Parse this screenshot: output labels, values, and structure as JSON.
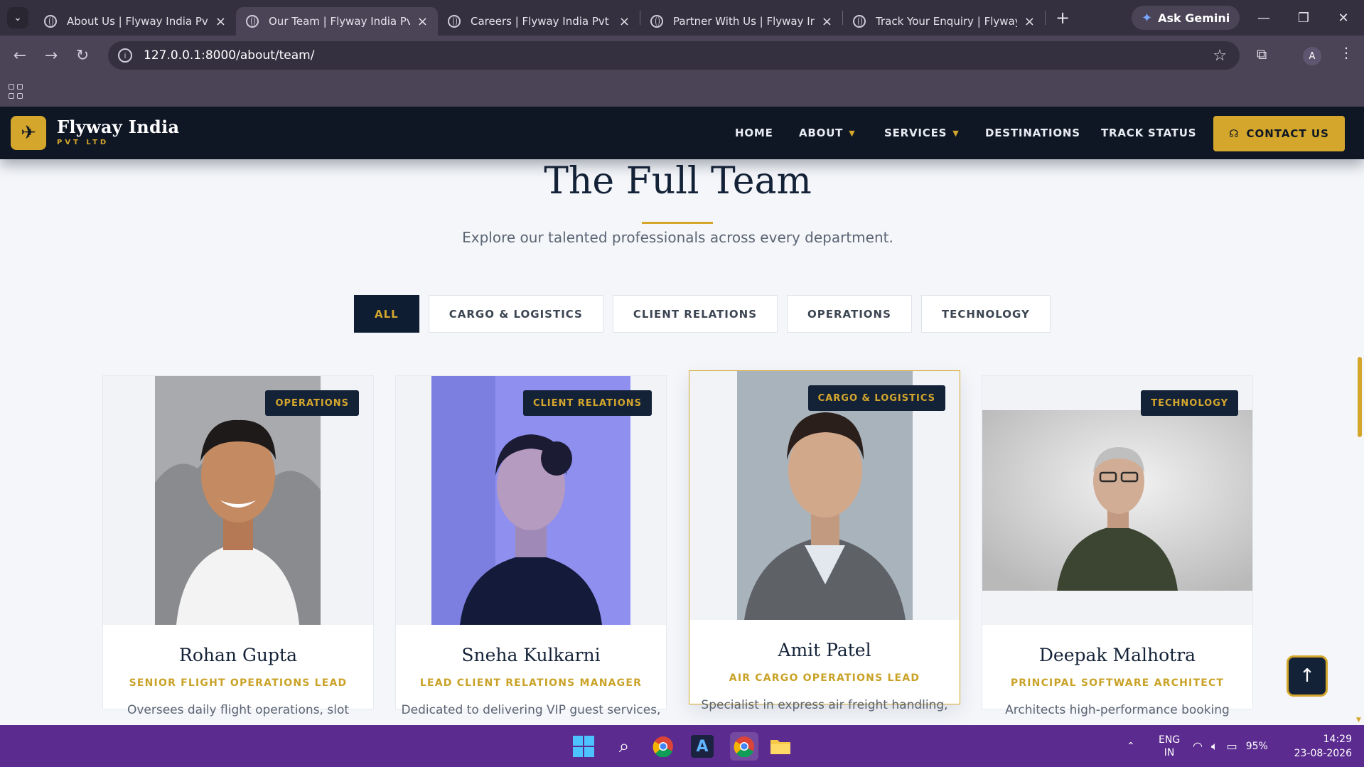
{
  "browser": {
    "tabs": [
      {
        "title": "About Us | Flyway India Pvt Ltd",
        "active": false
      },
      {
        "title": "Our Team | Flyway India Pvt Ltd",
        "active": true
      },
      {
        "title": "Careers | Flyway India Pvt Ltd",
        "active": false
      },
      {
        "title": "Partner With Us | Flyway India",
        "active": false
      },
      {
        "title": "Track Your Enquiry | Flyway India",
        "active": false
      }
    ],
    "ask_gemini": "Ask Gemini",
    "url": "127.0.0.1:8000/about/team/",
    "profile_initial": "A"
  },
  "site": {
    "brand": {
      "name": "Flyway India",
      "sub": "PVT LTD"
    },
    "nav": {
      "home": "HOME",
      "about": "ABOUT",
      "services": "SERVICES",
      "destinations": "DESTINATIONS",
      "track": "TRACK STATUS",
      "contact": "CONTACT US"
    },
    "heading": "The Full Team",
    "subheading": "Explore our talented professionals across every department.",
    "filters": [
      "ALL",
      "CARGO & LOGISTICS",
      "CLIENT RELATIONS",
      "OPERATIONS",
      "TECHNOLOGY"
    ],
    "active_filter": "ALL",
    "team": [
      {
        "name": "Rohan Gupta",
        "role": "SENIOR FLIGHT OPERATIONS LEAD",
        "department": "OPERATIONS",
        "description": "Oversees daily flight operations, slot"
      },
      {
        "name": "Sneha Kulkarni",
        "role": "LEAD CLIENT RELATIONS MANAGER",
        "department": "CLIENT RELATIONS",
        "description": "Dedicated to delivering VIP guest services,"
      },
      {
        "name": "Amit Patel",
        "role": "AIR CARGO OPERATIONS LEAD",
        "department": "CARGO & LOGISTICS",
        "description": "Specialist in express air freight handling,"
      },
      {
        "name": "Deepak Malhotra",
        "role": "PRINCIPAL SOFTWARE ARCHITECT",
        "department": "TECHNOLOGY",
        "description": "Architects high-performance booking"
      }
    ],
    "colors": {
      "navy": "#0f1724",
      "gold": "#d4a72c",
      "background": "#f4f6fa"
    }
  },
  "taskbar": {
    "language": "ENG",
    "region": "IN",
    "battery": "95%",
    "time": "14:29",
    "date": "23-08-2026"
  }
}
